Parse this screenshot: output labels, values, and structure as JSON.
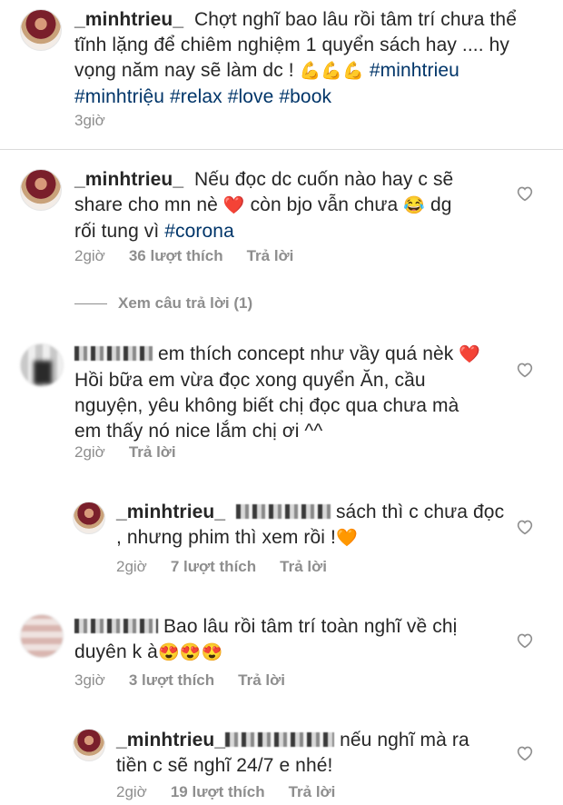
{
  "caption": {
    "user": "_minhtrieu_",
    "text_line1": "Chợt nghĩ bao lâu rồi tâm trí chưa thể",
    "text_line2": "tĩnh lặng để chiêm nghiệm 1 quyển sách hay .... hy",
    "text_line3a": "vọng năm nay sẽ làm dc !",
    "emoji_muscles": "💪💪💪",
    "hashtag_line3": "#minhtrieu",
    "hashtags_line4": "#minhtriệu #relax #love #book",
    "time": "3giờ"
  },
  "comments": [
    {
      "user": "_minhtrieu_",
      "line1": "Nếu đọc dc cuốn nào hay c sẽ",
      "line2a": "share cho mn nè",
      "emoji1": "❤️",
      "line2b": "còn bjo vẫn chưa",
      "emoji2": "😂",
      "line2c": "dg",
      "line3a": "rối tung vì",
      "hashtag": "#corona",
      "time": "2giờ",
      "likes": "36 lượt thích",
      "reply": "Trả lời",
      "view_replies": "Xem câu trả lời (1)"
    },
    {
      "line1": "em thích concept như vầy quá nèk",
      "emoji1": "❤️",
      "line2": "Hồi bữa em vừa đọc xong quyển Ăn, cầu",
      "line3": "nguyện, yêu không biết chị đọc qua chưa mà",
      "line4": "em thấy nó nice lắm chị ơi ^^",
      "time": "2giờ",
      "reply": "Trả lời"
    },
    {
      "user": "_minhtrieu_",
      "line1": "sách thì c chưa đọc",
      "line2": ", nhưng phim thì xem rồi !",
      "emoji": "🧡",
      "time": "2giờ",
      "likes": "7 lượt thích",
      "reply": "Trả lời"
    },
    {
      "line1": "Bao lâu rồi tâm trí toàn nghĩ về chị",
      "line2": "duyên k à",
      "emoji": "😍😍😍",
      "time": "3giờ",
      "likes": "3 lượt thích",
      "reply": "Trả lời"
    },
    {
      "user": "_minhtrieu_",
      "line1": "nếu nghĩ mà ra",
      "line2": "tiền c sẽ nghĩ 24/7 e nhé!",
      "time": "2giờ",
      "likes": "19 lượt thích",
      "reply": "Trả lời"
    }
  ]
}
